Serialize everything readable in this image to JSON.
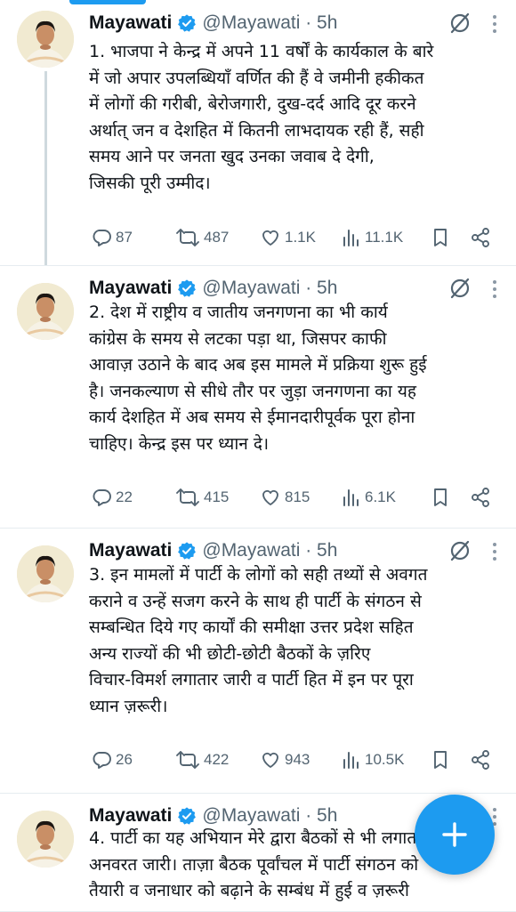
{
  "colors": {
    "accent": "#1d9bf0",
    "text": "#0f1419",
    "muted": "#536471"
  },
  "tweets": [
    {
      "name": "Mayawati",
      "handle": "@Mayawati · 5h",
      "text": [
        "1. भाजपा ने केन्द्र में अपने 11 वर्षों के कार्यकाल के बारे",
        "में जो अपार उपलब्धियाँ वर्णित की हैं वे जमीनी हकीकत",
        "में लोगों की गरीबी, बेरोजगारी, दुख-दर्द आदि दूर करने",
        "अर्थात् जन व देशहित में कितनी लाभदायक रही हैं, सही",
        "समय आने पर जनता खुद उनका  जवाब दे देगी,",
        "जिसकी पूरी उम्मीद।"
      ],
      "replies": "87",
      "reposts": "487",
      "likes": "1.1K",
      "views": "11.1K"
    },
    {
      "name": "Mayawati",
      "handle": "@Mayawati · 5h",
      "text": [
        "2. देश में राष्ट्रीय व जातीय जनगणना का भी कार्य",
        "कांग्रेस के समय से लटका पड़ा था, जिसपर काफी",
        "आवाज़ उठाने के बाद अब इस मामले में प्रक्रिया शुरू हुई",
        "है। जनकल्याण से सीधे तौर पर जुड़ा जनगणना का यह",
        "कार्य देशहित में अब समय से ईमानदारीपूर्वक पूरा होना",
        "चाहिए। केन्द्र इस पर ध्यान दे।"
      ],
      "replies": "22",
      "reposts": "415",
      "likes": "815",
      "views": "6.1K"
    },
    {
      "name": "Mayawati",
      "handle": "@Mayawati · 5h",
      "text": [
        "3. इन मामलों में पार्टी के लोगों को सही तथ्यों से अवगत",
        "कराने व उन्हें सजग करने के साथ ही पार्टी के संगठन से",
        "सम्बन्धित दिये गए कार्यों की समीक्षा उत्तर प्रदेश सहित",
        "अन्य राज्यों की भी छोटी-छोटी बैठकों के ज़रिए",
        "विचार-विमर्श लगातार जारी व पार्टी हित में इन पर पूरा",
        "ध्यान ज़रूरी।"
      ],
      "replies": "26",
      "reposts": "422",
      "likes": "943",
      "views": "10.5K"
    },
    {
      "name": "Mayawati",
      "handle": "@Mayawati · 5h",
      "text": [
        "4. पार्टी का यह अभियान मेरे द्वारा बैठकों से भी लगातार",
        "अनवरत जारी। ताज़ा बैठक पूर्वांचल में पार्टी संगठन को",
        "तैयारी व जनाधार को बढ़ाने के सम्बंध में हुई व ज़रूरी"
      ]
    }
  ],
  "icons": {
    "verified": "verified-badge-icon",
    "grok": "grok-icon",
    "fab": "compose-plus-icon"
  }
}
